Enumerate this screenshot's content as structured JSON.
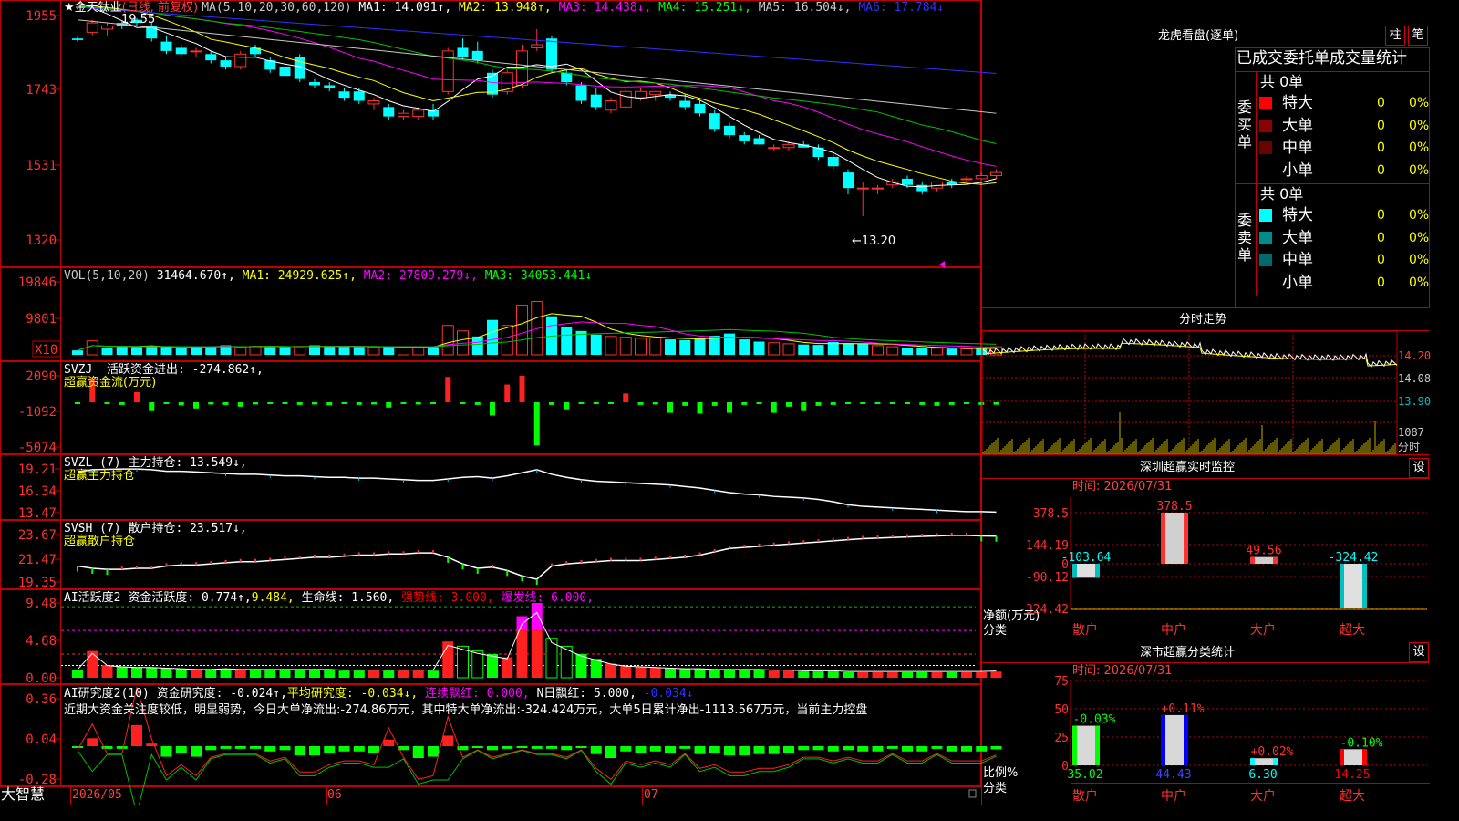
{
  "stock": {
    "star": "★",
    "name": "金天钛业",
    "mode": "(日线, 前复权)"
  },
  "ma_line": [
    {
      "t": "MA(5,10,20,30,60,120)",
      "c": "#c8c8c8"
    },
    {
      "t": "MA1: 14.091↑,",
      "c": "#ffffff"
    },
    {
      "t": "MA2: 13.948↑,",
      "c": "#ffff00"
    },
    {
      "t": "MA3: 14.438↓,",
      "c": "#ff00ff"
    },
    {
      "t": "MA4: 15.251↓,",
      "c": "#00ff00"
    },
    {
      "t": "MA5: 16.504↓,",
      "c": "#c8c8c8"
    },
    {
      "t": "MA6: 17.784↓",
      "c": "#3030ff"
    }
  ],
  "price_labels": [
    "1955",
    "1743",
    "1531",
    "1320"
  ],
  "high_note": "19.55",
  "low_note": "←13.20",
  "vol_title": [
    {
      "t": "VOL(5,10,20)",
      "c": "#c8c8c8"
    },
    {
      "t": "31464.670↑,",
      "c": "#ffffff"
    },
    {
      "t": "MA1: 24929.625↑,",
      "c": "#ffff00"
    },
    {
      "t": "MA2: 27809.279↓,",
      "c": "#ff00ff"
    },
    {
      "t": "MA3: 34053.441↓",
      "c": "#00ff00"
    }
  ],
  "vol_labels": [
    "19846",
    "9801",
    "X10"
  ],
  "svzj": {
    "l1a": "SVZJ",
    "l1b": "活跃资金进出: -274.862↑,",
    "l2": "超赢资金流(万元)",
    "labels": [
      "2090",
      "-1092",
      "-5074"
    ]
  },
  "svzl": {
    "l1a": "SVZL (7)",
    "l1b": "主力持仓: 13.549↓,",
    "l2": "超赢主力持仓",
    "labels": [
      "19.21",
      "16.34",
      "13.47"
    ]
  },
  "svsh": {
    "l1a": "SVSH (7)",
    "l1b": "散户持仓: 23.517↓,",
    "l2": "超赢散户持仓",
    "labels": [
      "23.67",
      "21.47",
      "19.35"
    ]
  },
  "ai1": {
    "t1": "AI活跃度2",
    "t2": "资金活跃度: 0.774↑,",
    "t3": "9.484,",
    "t4": "生命线: 1.560,",
    "t5": "强势线: 3.000,",
    "t6": "爆发线: 6.000,",
    "labels": [
      "9.48",
      "4.68",
      "0.00"
    ]
  },
  "ai2": {
    "t1": "AI研究度2(10)",
    "t2": "资金研究度: -0.024↑,",
    "t3": "平均研究度: -0.034↓,",
    "t4": "连续飘红: 0.000,",
    "t5": "N日飘红: 5.000,",
    "t6": "-0.034↓",
    "labels": [
      "0.36",
      "0.04",
      "-0.28"
    ],
    "comment": "近期大资金关注度较低，明显弱势，今日大单净流出:-274.86万元，其中特大单净流出:-324.424万元，大单5日累计净出-1113.567万元，当前主力控盘"
  },
  "dates": [
    "2026/05",
    "06",
    "07"
  ],
  "brand": "大智慧",
  "right": {
    "lh_title": "龙虎看盘(逐单)",
    "btn_zhu": "柱",
    "btn_bi": "笔",
    "tabs": [
      "已成交",
      "委托单",
      "成交量统计"
    ],
    "buy_label": "委买单",
    "sell_label": "委卖单",
    "total": "共 0单",
    "rows": [
      {
        "name": "特大",
        "v": "0",
        "p": "0%",
        "c": "#ff0000"
      },
      {
        "name": "大单",
        "v": "0",
        "p": "0%",
        "c": "#8b0000"
      },
      {
        "name": "中单",
        "v": "0",
        "p": "0%",
        "c": "#6a0000"
      },
      {
        "name": "小单",
        "v": "0",
        "p": "0%",
        "c": ""
      }
    ],
    "srows": [
      {
        "name": "特大",
        "v": "0",
        "p": "0%",
        "c": "#00ffff"
      },
      {
        "name": "大单",
        "v": "0",
        "p": "0%",
        "c": "#008b8b"
      },
      {
        "name": "中单",
        "v": "0",
        "p": "0%",
        "c": "#006a6a"
      },
      {
        "name": "小单",
        "v": "0",
        "p": "0%",
        "c": ""
      }
    ],
    "fs_title": "分时走势",
    "fs_labels": [
      "14.20",
      "14.08",
      "13.90"
    ],
    "fs_vol": "1087",
    "fs_vol2": "分时",
    "mon_title": "深圳超赢实时监控",
    "shi": "设",
    "time": "时间: 2026/07/31",
    "mon_axis": [
      "378.5",
      "144.19",
      "0",
      "-90.12",
      "-324.42"
    ],
    "mon_side": [
      "净额(万元)",
      "分类"
    ],
    "cat_title": "深市超赢分类统计",
    "cat_axis": [
      "75",
      "50",
      "25",
      "0"
    ],
    "cat_side": [
      "比例%",
      "分类"
    ],
    "categories": [
      "散户",
      "中户",
      "大户",
      "超大"
    ]
  },
  "chart_data": [
    {
      "type": "candlestick",
      "title": "金天钛业 (日线, 前复权)",
      "ylim": [
        13.2,
        19.55
      ],
      "high": 19.55,
      "low": 13.2,
      "ohlc": [
        [
          18.9,
          18.95,
          18.8,
          18.85
        ],
        [
          19.1,
          19.5,
          19.0,
          19.4
        ],
        [
          19.2,
          19.4,
          19.0,
          19.3
        ],
        [
          19.4,
          19.45,
          19.2,
          19.3
        ],
        [
          19.5,
          19.55,
          19.3,
          19.4
        ],
        [
          19.3,
          19.4,
          18.8,
          18.9
        ],
        [
          18.8,
          19.0,
          18.4,
          18.5
        ],
        [
          18.6,
          18.7,
          18.3,
          18.4
        ],
        [
          18.5,
          18.6,
          18.3,
          18.5
        ],
        [
          18.4,
          18.5,
          18.1,
          18.2
        ],
        [
          18.2,
          18.3,
          17.9,
          18.0
        ],
        [
          18.0,
          18.5,
          17.9,
          18.4
        ],
        [
          18.6,
          18.7,
          18.3,
          18.4
        ],
        [
          18.2,
          18.3,
          17.8,
          17.9
        ],
        [
          18.0,
          18.1,
          17.6,
          17.7
        ],
        [
          18.3,
          18.4,
          17.5,
          17.6
        ],
        [
          17.5,
          17.6,
          17.3,
          17.4
        ],
        [
          17.4,
          17.5,
          17.2,
          17.3
        ],
        [
          17.2,
          17.3,
          16.9,
          17.0
        ],
        [
          17.2,
          17.3,
          16.8,
          16.9
        ],
        [
          16.8,
          17.0,
          16.6,
          16.9
        ],
        [
          16.7,
          16.8,
          16.3,
          16.4
        ],
        [
          16.4,
          16.6,
          16.3,
          16.5
        ],
        [
          16.4,
          16.7,
          16.3,
          16.6
        ],
        [
          16.6,
          16.8,
          16.3,
          16.4
        ],
        [
          17.2,
          18.6,
          17.1,
          18.5
        ],
        [
          18.6,
          18.9,
          18.2,
          18.3
        ],
        [
          18.5,
          18.8,
          18.1,
          18.2
        ],
        [
          17.8,
          17.9,
          17.0,
          17.1
        ],
        [
          17.2,
          17.9,
          17.1,
          17.8
        ],
        [
          17.4,
          18.7,
          17.3,
          18.5
        ],
        [
          18.6,
          19.2,
          18.5,
          18.7
        ],
        [
          18.9,
          19.0,
          17.8,
          17.9
        ],
        [
          17.8,
          17.9,
          17.4,
          17.5
        ],
        [
          17.4,
          17.5,
          16.8,
          16.9
        ],
        [
          17.1,
          17.3,
          16.6,
          16.7
        ],
        [
          16.6,
          17.0,
          16.5,
          16.9
        ],
        [
          16.7,
          17.3,
          16.6,
          17.2
        ],
        [
          17.0,
          17.3,
          16.9,
          17.2
        ],
        [
          17.1,
          17.2,
          16.9,
          17.2
        ],
        [
          17.1,
          17.2,
          16.9,
          17.0
        ],
        [
          16.9,
          17.1,
          16.6,
          16.7
        ],
        [
          16.8,
          16.9,
          16.4,
          16.5
        ],
        [
          16.5,
          16.6,
          15.9,
          16.0
        ],
        [
          16.1,
          16.2,
          15.7,
          15.8
        ],
        [
          15.8,
          15.9,
          15.5,
          15.6
        ],
        [
          15.7,
          15.8,
          15.5,
          15.5
        ],
        [
          15.4,
          15.5,
          15.3,
          15.4
        ],
        [
          15.4,
          15.6,
          15.3,
          15.5
        ],
        [
          15.5,
          15.6,
          15.4,
          15.4
        ],
        [
          15.4,
          15.5,
          15.0,
          15.1
        ],
        [
          15.1,
          15.2,
          14.7,
          14.8
        ],
        [
          14.6,
          14.7,
          13.9,
          14.1
        ],
        [
          14.1,
          14.3,
          13.2,
          14.1
        ],
        [
          14.1,
          14.2,
          13.9,
          14.1
        ],
        [
          14.2,
          14.4,
          14.1,
          14.3
        ],
        [
          14.4,
          14.5,
          14.1,
          14.2
        ],
        [
          14.2,
          14.3,
          13.9,
          14.0
        ],
        [
          14.1,
          14.3,
          14.0,
          14.3
        ],
        [
          14.3,
          14.4,
          14.1,
          14.2
        ],
        [
          14.4,
          14.5,
          14.3,
          14.4
        ],
        [
          14.4,
          14.6,
          14.4,
          14.5
        ],
        [
          14.5,
          14.7,
          14.4,
          14.6
        ]
      ],
      "ma_last": {
        "MA1": 14.091,
        "MA2": 13.948,
        "MA3": 14.438,
        "MA4": 15.251,
        "MA5": 16.504,
        "MA6": 17.784
      }
    },
    {
      "type": "bar",
      "title": "VOL(5,10,20)",
      "ylim": [
        0,
        19846
      ],
      "values": [
        1200,
        3800,
        2000,
        2200,
        2100,
        2200,
        2300,
        2000,
        2100,
        2200,
        2600,
        2100,
        2300,
        2200,
        2100,
        2300,
        2600,
        2300,
        2200,
        2100,
        2000,
        2200,
        2100,
        2000,
        2100,
        8000,
        6500,
        5000,
        9500,
        8000,
        13500,
        14500,
        10500,
        7500,
        6500,
        5500,
        5000,
        4800,
        4500,
        4600,
        4200,
        4000,
        4500,
        5200,
        5800,
        4200,
        3600,
        3300,
        3000,
        2800,
        2700,
        3500,
        3200,
        3000,
        2500,
        2200,
        1900,
        1800,
        1800,
        1700,
        1600,
        1600,
        2200
      ],
      "up": [
        0,
        1,
        0,
        0,
        0,
        0,
        0,
        0,
        0,
        0,
        0,
        1,
        1,
        0,
        0,
        1,
        0,
        0,
        0,
        0,
        1,
        0,
        1,
        1,
        0,
        1,
        1,
        0,
        0,
        1,
        1,
        1,
        0,
        0,
        0,
        0,
        1,
        1,
        1,
        1,
        0,
        0,
        0,
        0,
        0,
        0,
        0,
        1,
        1,
        0,
        0,
        0,
        0,
        0,
        1,
        1,
        0,
        0,
        1,
        0,
        1,
        0,
        1
      ]
    },
    {
      "type": "bar",
      "title": "超赢资金流(万元)",
      "ylim": [
        -5074,
        2090
      ],
      "values": [
        -200,
        1900,
        -150,
        -300,
        800,
        -900,
        -200,
        -350,
        -700,
        -250,
        -300,
        -500,
        -250,
        -200,
        -150,
        -300,
        -250,
        -350,
        -200,
        -300,
        -250,
        -600,
        -150,
        -250,
        -200,
        2000,
        -200,
        -300,
        -1500,
        1400,
        2100,
        -4900,
        -300,
        -800,
        -150,
        -200,
        -150,
        700,
        -300,
        -250,
        -1200,
        -400,
        -1300,
        -400,
        -1200,
        -300,
        -200,
        -1200,
        -500,
        -900,
        -400,
        -300,
        -200,
        -100,
        -100,
        -200,
        -100,
        -300,
        -400,
        -300,
        -100,
        -300,
        -275
      ]
    },
    {
      "type": "line",
      "title": "超赢主力持仓",
      "ylim": [
        13.47,
        19.21
      ],
      "values": [
        18.8,
        19.1,
        19.15,
        19.2,
        19.2,
        19.1,
        18.9,
        18.9,
        18.8,
        18.7,
        18.6,
        18.5,
        18.5,
        18.4,
        18.3,
        18.3,
        18.2,
        18.1,
        18.1,
        18.0,
        18.0,
        17.9,
        17.8,
        17.7,
        17.7,
        17.9,
        18.1,
        18.2,
        18.0,
        18.3,
        18.7,
        19.1,
        18.5,
        18.1,
        17.8,
        17.6,
        17.5,
        17.4,
        17.3,
        17.2,
        17.1,
        16.9,
        16.7,
        16.4,
        16.1,
        15.9,
        15.8,
        15.6,
        15.5,
        15.4,
        15.2,
        14.9,
        14.5,
        14.3,
        14.2,
        14.1,
        14.0,
        13.9,
        13.8,
        13.7,
        13.6,
        13.6,
        13.55
      ]
    },
    {
      "type": "line",
      "title": "超赢散户持仓",
      "ylim": [
        19.35,
        23.67
      ],
      "values": [
        20.8,
        20.6,
        20.5,
        20.5,
        20.6,
        20.6,
        20.8,
        20.9,
        20.9,
        21.0,
        21.1,
        21.2,
        21.2,
        21.3,
        21.4,
        21.5,
        21.6,
        21.6,
        21.7,
        21.8,
        21.8,
        21.9,
        21.9,
        22.0,
        22.0,
        21.6,
        21.0,
        20.6,
        20.7,
        20.4,
        19.9,
        19.6,
        20.8,
        21.0,
        21.1,
        21.2,
        21.3,
        21.3,
        21.3,
        21.4,
        21.5,
        21.6,
        21.8,
        22.1,
        22.4,
        22.5,
        22.6,
        22.7,
        22.8,
        22.9,
        23.0,
        23.1,
        23.2,
        23.3,
        23.35,
        23.4,
        23.45,
        23.5,
        23.55,
        23.6,
        23.6,
        23.55,
        23.52
      ]
    },
    {
      "type": "bar",
      "title": "AI活跃度2",
      "ylim": [
        0,
        9.48
      ],
      "values": [
        1.0,
        3.4,
        1.6,
        1.4,
        1.3,
        1.3,
        1.2,
        1.1,
        1.0,
        1.0,
        1.1,
        1.0,
        1.0,
        1.0,
        1.0,
        1.0,
        1.0,
        1.0,
        0.9,
        0.9,
        0.9,
        0.9,
        0.9,
        0.9,
        0.9,
        4.6,
        4.0,
        3.4,
        3.0,
        2.6,
        7.8,
        9.48,
        5.0,
        4.0,
        3.0,
        2.4,
        1.8,
        1.5,
        1.4,
        1.3,
        1.2,
        1.1,
        1.1,
        1.0,
        1.0,
        1.0,
        1.0,
        0.9,
        0.9,
        0.8,
        0.8,
        0.8,
        0.7,
        0.7,
        0.7,
        0.7,
        0.7,
        0.7,
        0.7,
        0.7,
        0.7,
        0.7,
        0.774
      ]
    },
    {
      "type": "bar",
      "title": "AI研究度2(10)",
      "ylim": [
        -0.28,
        0.36
      ],
      "values": [
        -0.01,
        0.06,
        -0.02,
        -0.02,
        0.16,
        0.02,
        -0.08,
        -0.05,
        -0.08,
        -0.03,
        -0.02,
        -0.02,
        -0.02,
        -0.04,
        -0.03,
        -0.07,
        -0.07,
        -0.05,
        -0.04,
        -0.04,
        -0.05,
        0.05,
        -0.03,
        -0.09,
        -0.08,
        0.08,
        -0.03,
        -0.01,
        -0.03,
        -0.02,
        -0.01,
        -0.02,
        -0.02,
        -0.03,
        -0.01,
        -0.06,
        -0.09,
        -0.04,
        -0.05,
        -0.04,
        -0.05,
        -0.02,
        -0.06,
        -0.05,
        -0.07,
        -0.07,
        -0.06,
        -0.06,
        -0.05,
        -0.03,
        -0.03,
        -0.04,
        -0.03,
        -0.04,
        -0.04,
        -0.02,
        -0.04,
        -0.04,
        -0.02,
        -0.04,
        -0.04,
        -0.04,
        -0.024
      ]
    },
    {
      "type": "bar",
      "title": "深圳超赢实时监控",
      "categories": [
        "散户",
        "中户",
        "大户",
        "超大"
      ],
      "values": [
        -103.64,
        378.5,
        49.56,
        -324.42
      ],
      "ylim": [
        -324.42,
        378.5
      ]
    },
    {
      "type": "bar",
      "title": "深市超赢分类统计",
      "categories": [
        "散户",
        "中户",
        "大户",
        "超大"
      ],
      "values": [
        35.02,
        44.43,
        6.3,
        14.25
      ],
      "changes": [
        "-0.03%",
        "+0.11%",
        "+0.02%",
        "-0.10%"
      ],
      "ylim": [
        0,
        75
      ]
    }
  ]
}
